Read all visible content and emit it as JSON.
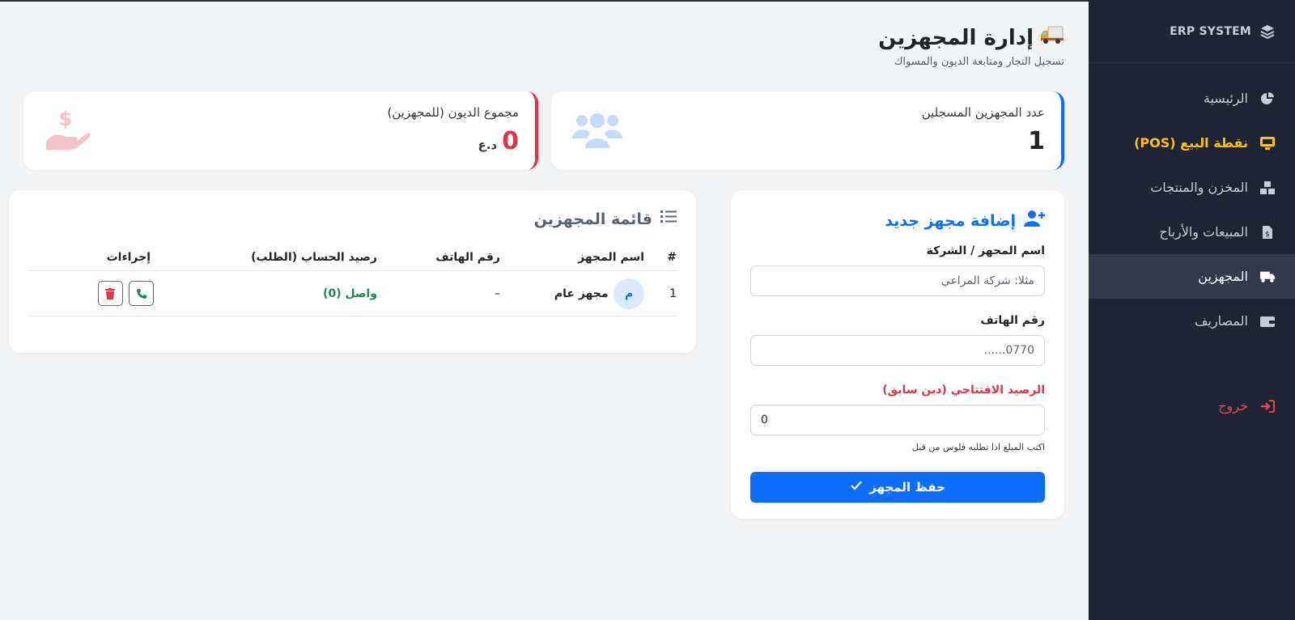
{
  "brand": {
    "name": "ERP SYSTEM"
  },
  "sidebar": {
    "items": [
      {
        "label": "الرئيسية",
        "icon": "pie-chart-icon"
      },
      {
        "label": "نقطة البيع (POS)",
        "icon": "monitor-icon"
      },
      {
        "label": "المخزن والمنتجات",
        "icon": "boxes-icon"
      },
      {
        "label": "المبيعات والأرباح",
        "icon": "invoice-dollar-icon"
      },
      {
        "label": "المجهزين",
        "icon": "truck-icon"
      },
      {
        "label": "المصاريف",
        "icon": "wallet-icon"
      }
    ],
    "logout": {
      "label": "خروج",
      "icon": "sign-out-icon"
    }
  },
  "header": {
    "title": "إدارة المجهزين",
    "subtitle": "تسجيل التجار ومتابعة الديون والمسواك",
    "icon": "truck-emoji"
  },
  "stats": {
    "suppliers_count": {
      "label": "عدد المجهزين المسجلين",
      "value": "1",
      "icon": "users-icon",
      "accent": "#0d6efd"
    },
    "total_debt": {
      "label": "مجموع الديون (للمجهزين)",
      "value": "0",
      "currency": "د.ع",
      "icon": "hand-dollar-icon",
      "accent": "#dc3545"
    }
  },
  "form": {
    "title": "إضافة مجهز جديد",
    "name_label": "اسم المجهز / الشركة",
    "name_placeholder": "مثلا: شركة المراعي",
    "phone_label": "رقم الهاتف",
    "phone_placeholder": "0770......",
    "balance_label": "الرصيد الافتتاحي (دين سابق)",
    "balance_value": "0",
    "balance_hint": "اكتب المبلغ اذا تطلبه فلوس من قبل",
    "save_label": "حفظ المجهز"
  },
  "list": {
    "title": "قائمة المجهزين",
    "columns": [
      "#",
      "اسم المجهز",
      "رقم الهاتف",
      "رصيد الحساب (الطلب)",
      "إجراءات"
    ],
    "rows": [
      {
        "index": "1",
        "avatar": "م",
        "name": "مجهز عام",
        "phone": "–",
        "balance": "واصل (0)"
      }
    ]
  },
  "colors": {
    "primary": "#0d6efd",
    "danger": "#dc3545",
    "success": "#198754",
    "warning": "#ffc107",
    "sidebar_bg": "#1e2433"
  }
}
